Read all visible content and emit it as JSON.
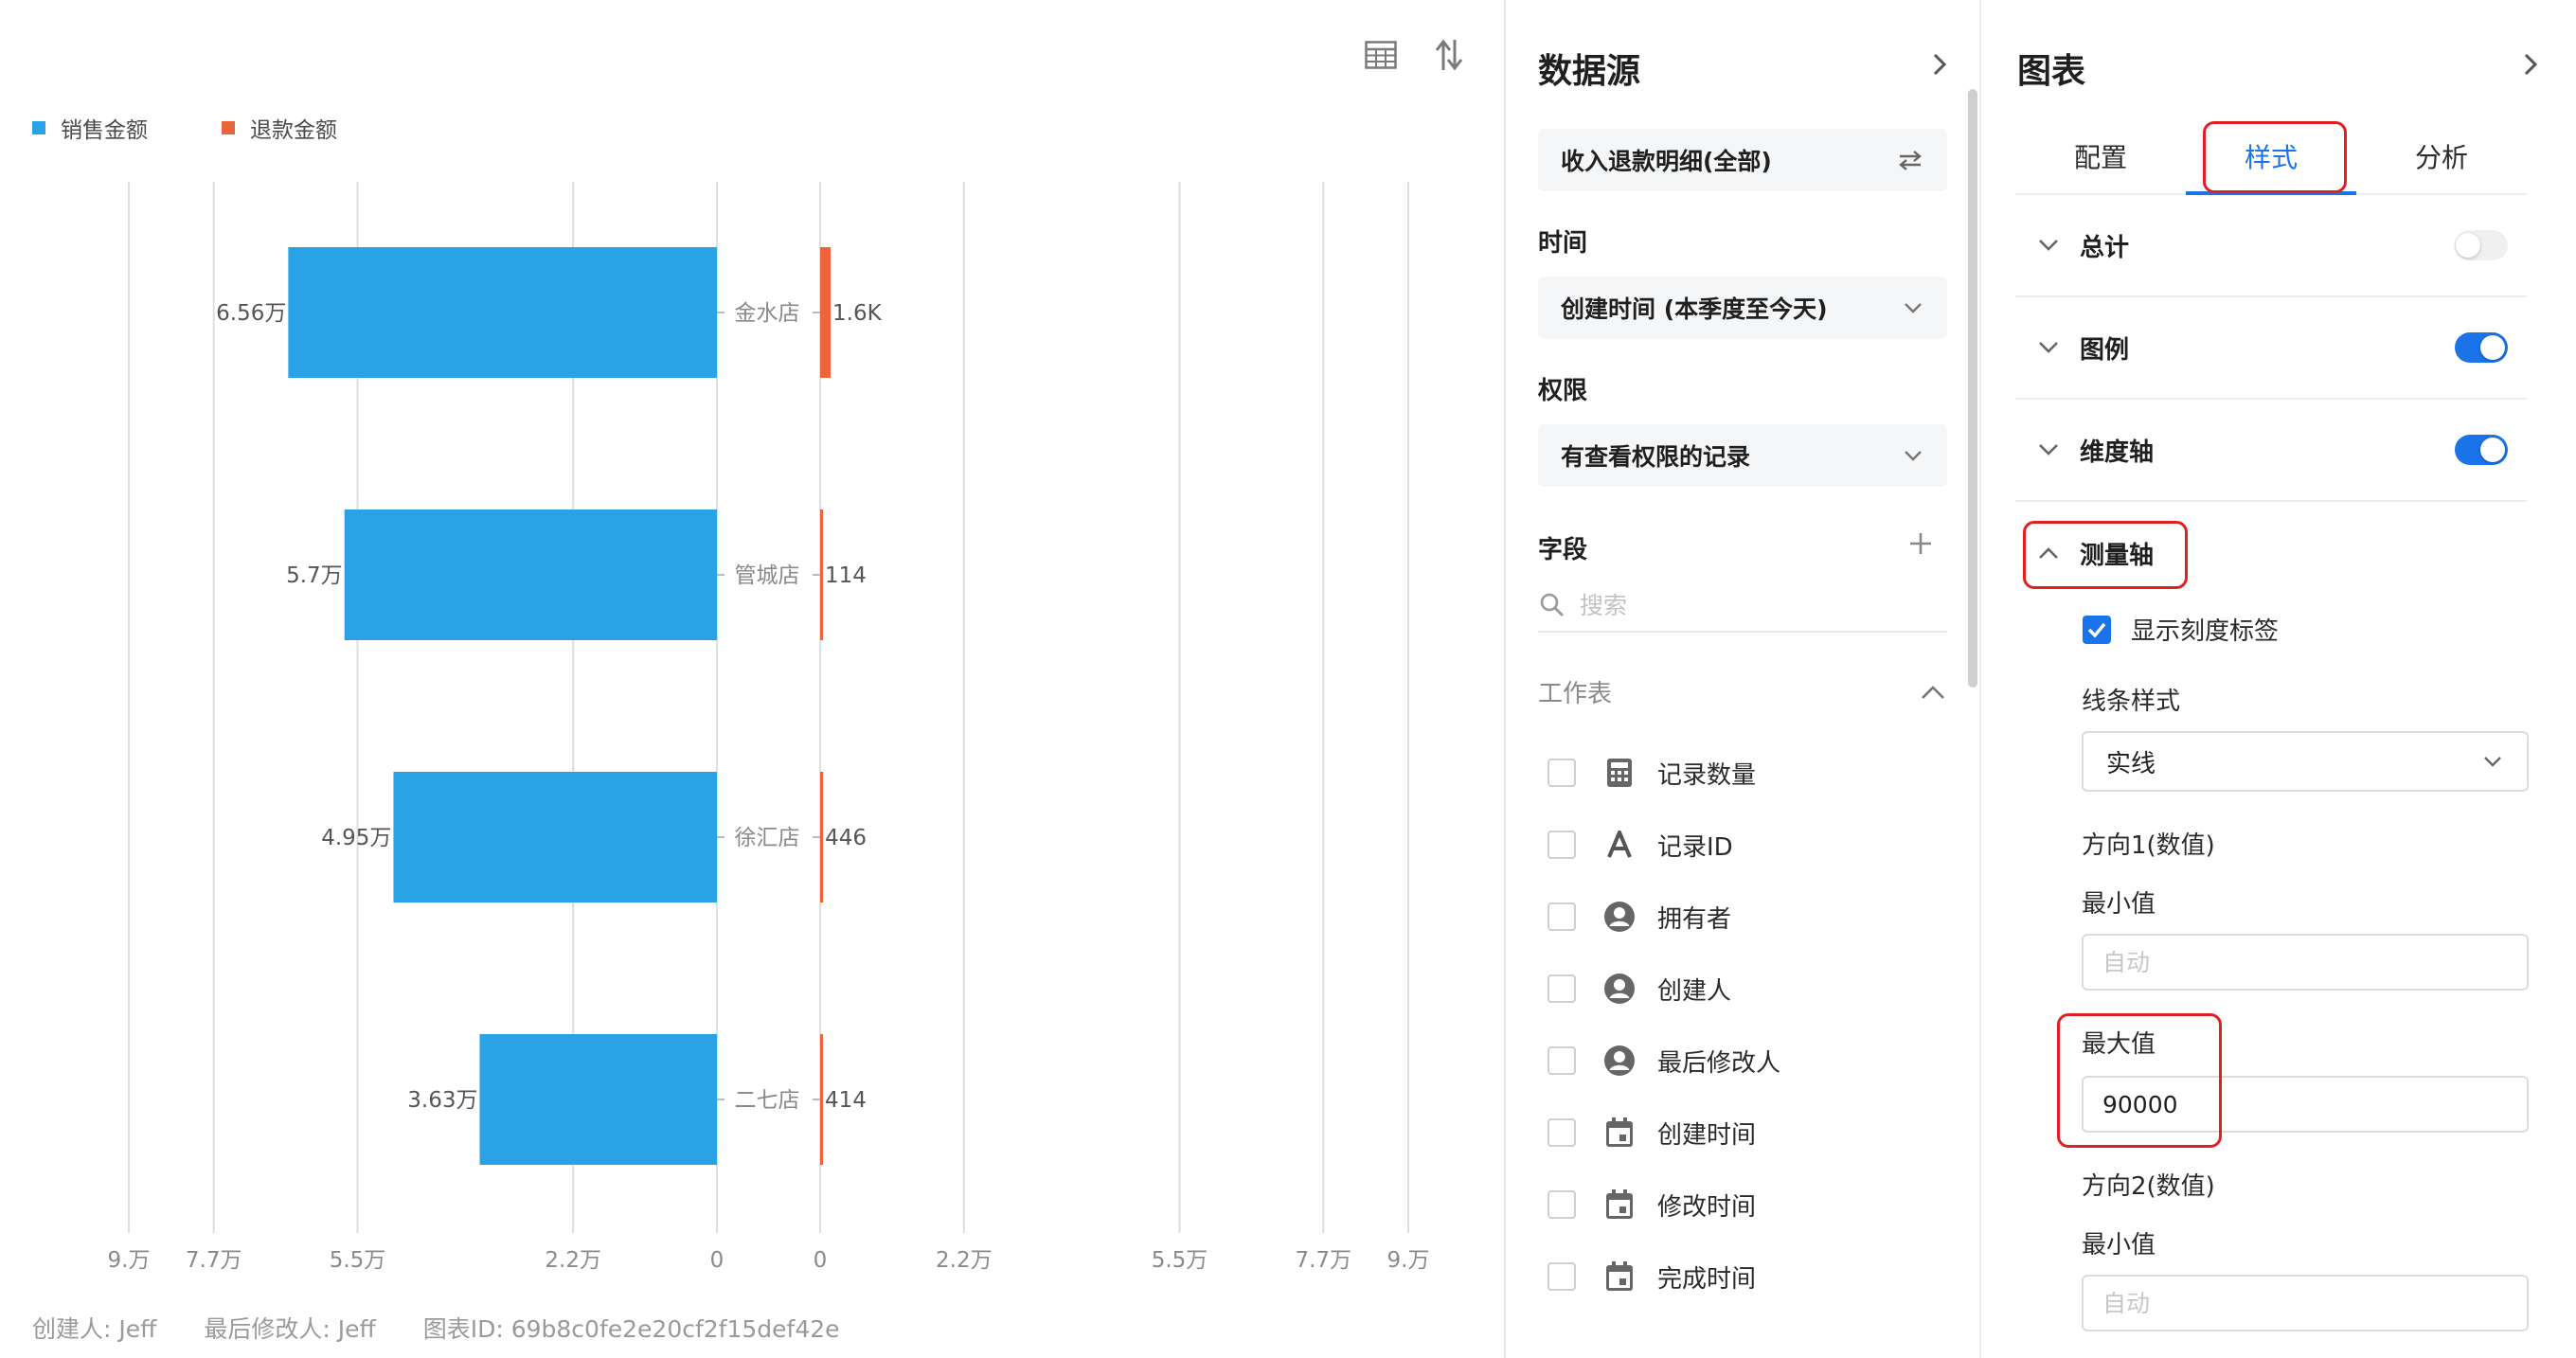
{
  "chart_panel": {
    "toolbar": {
      "table_icon": "table-icon",
      "swap_icon": "swap-vertical-icon"
    },
    "legend": [
      {
        "name": "销售金额",
        "color": "#29a3e6"
      },
      {
        "name": "退款金额",
        "color": "#e8663a"
      }
    ],
    "footer": {
      "creator": "创建人: Jeff",
      "modifier": "最后修改人: Jeff",
      "chart_id": "图表ID: 69b8c0fe2e20cf2f15def42e"
    }
  },
  "chart_data": {
    "type": "bar",
    "orientation": "horizontal",
    "layout": "butterfly",
    "categories": [
      "金水店",
      "管城店",
      "徐汇店",
      "二七店"
    ],
    "series": [
      {
        "name": "销售金额",
        "color": "#29a3e6",
        "values": [
          65600,
          57000,
          49500,
          36300
        ],
        "labels": [
          "6.56万",
          "5.7万",
          "4.95万",
          "3.63万"
        ],
        "side": "left"
      },
      {
        "name": "退款金额",
        "color": "#e8663a",
        "values": [
          1600,
          114,
          446,
          414
        ],
        "labels": [
          "1.6K",
          "114",
          "446",
          "414"
        ],
        "side": "right"
      }
    ],
    "left_axis": {
      "ticks": [
        0,
        22000,
        55000,
        77000,
        90000
      ],
      "tick_labels": [
        "0",
        "2.2万",
        "5.5万",
        "7.7万",
        "9.万"
      ],
      "max": 90000
    },
    "right_axis": {
      "ticks": [
        0,
        22000,
        55000,
        77000,
        90000
      ],
      "tick_labels": [
        "0",
        "2.2万",
        "5.5万",
        "7.7万",
        "9.万"
      ],
      "max": 90000
    },
    "grid": true,
    "legend_position": "top-left"
  },
  "data_source": {
    "title": "数据源",
    "dataset": "收入退款明细(全部)",
    "time_label": "时间",
    "time_value": "创建时间 (本季度至今天)",
    "permission_label": "权限",
    "permission_value": "有查看权限的记录",
    "fields_label": "字段",
    "search_placeholder": "搜索",
    "worksheet_label": "工作表",
    "fields": [
      {
        "label": "记录数量",
        "icon": "calculator-icon"
      },
      {
        "label": "记录ID",
        "icon": "text-a-icon"
      },
      {
        "label": "拥有者",
        "icon": "user-icon"
      },
      {
        "label": "创建人",
        "icon": "user-icon"
      },
      {
        "label": "最后修改人",
        "icon": "user-icon"
      },
      {
        "label": "创建时间",
        "icon": "calendar-icon"
      },
      {
        "label": "修改时间",
        "icon": "calendar-icon"
      },
      {
        "label": "完成时间",
        "icon": "calendar-icon"
      }
    ]
  },
  "chart_config": {
    "title": "图表",
    "tabs": [
      {
        "label": "配置",
        "active": false
      },
      {
        "label": "样式",
        "active": true
      },
      {
        "label": "分析",
        "active": false
      }
    ],
    "sections": [
      {
        "label": "总计",
        "toggle": false
      },
      {
        "label": "图例",
        "toggle": true
      },
      {
        "label": "维度轴",
        "toggle": true
      }
    ],
    "measure_axis": {
      "label": "测量轴",
      "show_tick_labels": "显示刻度标签",
      "show_tick_labels_checked": true,
      "line_style_label": "线条样式",
      "line_style_value": "实线",
      "dir1_label": "方向1(数值)",
      "dir1_min_label": "最小值",
      "dir1_min_placeholder": "自动",
      "dir1_max_label": "最大值",
      "dir1_max_value": "90000",
      "dir2_label": "方向2(数值)",
      "dir2_min_label": "最小值",
      "dir2_min_placeholder": "自动"
    },
    "accent_color": "#1a73e8",
    "highlight_color": "#e02020"
  }
}
